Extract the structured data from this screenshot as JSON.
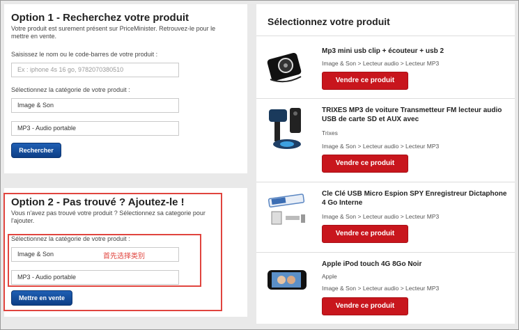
{
  "option1": {
    "title": "Option 1 - Recherchez votre produit",
    "intro": "Votre produit est surement présent sur PriceMinister. Retrouvez-le pour le mettre en vente.",
    "search_label": "Saisissez le nom ou le code-barres de votre produit :",
    "search_placeholder": "Ex : iphone 4s 16 go,  9782070380510",
    "category_label": "Sélectionnez la catégorie de votre produit :",
    "category_value": "Image & Son",
    "subcategory_value": "MP3 - Audio portable",
    "button": "Rechercher"
  },
  "option2": {
    "title": "Option 2 - Pas trouvé ? Ajoutez-le !",
    "intro": "Vous n'avez pas trouvé votre produit ? Sélectionnez sa categorie pour l'ajouter.",
    "category_label": "Sélectionnez la catégorie de votre produit :",
    "category_value": "Image & Son",
    "subcategory_value": "MP3 - Audio portable",
    "button": "Mettre en vente",
    "annotation": "首先选择类别"
  },
  "results": {
    "title": "Sélectionnez votre produit",
    "items": [
      {
        "name": "Mp3 mini usb clip + écouteur + usb 2",
        "brand": "",
        "breadcrumb": "Image & Son >  Lecteur audio >  Lecteur MP3",
        "button": "Vendre ce produit"
      },
      {
        "name": "TRIXES MP3 de voiture Transmetteur FM lecteur audio USB de carte SD et AUX avec",
        "brand": "Trixes",
        "breadcrumb": "Image & Son >  Lecteur audio >  Lecteur MP3",
        "button": "Vendre ce produit"
      },
      {
        "name": "Cle Clé USB Micro Espion SPY Enregistreur Dictaphone 4 Go Interne",
        "brand": "",
        "breadcrumb": "Image & Son >  Lecteur audio >  Lecteur MP3",
        "button": "Vendre ce produit"
      },
      {
        "name": "Apple iPod touch 4G 8Go Noir",
        "brand": "Apple",
        "breadcrumb": "Image & Son >  Lecteur audio >  Lecteur MP3",
        "button": "Vendre ce produit"
      }
    ]
  },
  "colors": {
    "accent_red": "#c8161d",
    "button_blue": "#0d3f87",
    "annotation_red": "#e0443e"
  }
}
